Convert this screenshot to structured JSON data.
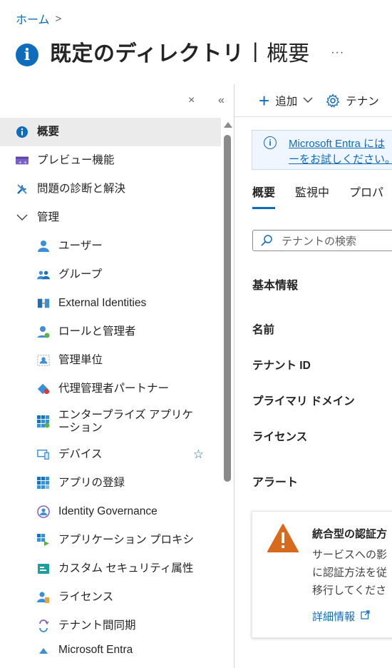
{
  "breadcrumb": {
    "home": "ホーム",
    "sep": ">"
  },
  "header": {
    "title": "既定のディレクトリ",
    "separator": "|",
    "subtitle": "概要",
    "more": "···"
  },
  "sidebar": {
    "collapse_icon": "×",
    "hide_icon": "«",
    "items": [
      {
        "label": "概要",
        "icon": "info-icon",
        "level": 0,
        "active": true
      },
      {
        "label": "プレビュー機能",
        "icon": "preview-features-icon",
        "level": 0
      },
      {
        "label": "問題の診断と解決",
        "icon": "wrench-icon",
        "level": 0
      },
      {
        "label": "管理",
        "icon": "chevron-down-icon",
        "level": 0
      },
      {
        "label": "ユーザー",
        "icon": "user-icon",
        "level": 1
      },
      {
        "label": "グループ",
        "icon": "group-icon",
        "level": 1
      },
      {
        "label": "External Identities",
        "icon": "external-identities-icon",
        "level": 1
      },
      {
        "label": "ロールと管理者",
        "icon": "roles-icon",
        "level": 1
      },
      {
        "label": "管理単位",
        "icon": "admin-units-icon",
        "level": 1
      },
      {
        "label": "代理管理者パートナー",
        "icon": "partner-icon",
        "level": 1
      },
      {
        "label": "エンタープライズ アプリケーション",
        "icon": "enterprise-apps-icon",
        "level": 1
      },
      {
        "label": "デバイス",
        "icon": "devices-icon",
        "level": 1,
        "star": "☆"
      },
      {
        "label": "アプリの登録",
        "icon": "app-registrations-icon",
        "level": 1
      },
      {
        "label": "Identity Governance",
        "icon": "identity-governance-icon",
        "level": 1
      },
      {
        "label": "アプリケーション プロキシ",
        "icon": "app-proxy-icon",
        "level": 1
      },
      {
        "label": "カスタム セキュリティ属性",
        "icon": "security-attributes-icon",
        "level": 1
      },
      {
        "label": "ライセンス",
        "icon": "licenses-icon",
        "level": 1
      },
      {
        "label": "テナント間同期",
        "icon": "sync-icon",
        "level": 1
      },
      {
        "label": "Microsoft Entra",
        "icon": "entra-icon",
        "level": 1
      }
    ]
  },
  "toolbar": {
    "add_label": "追加",
    "tenant_label": "テナン"
  },
  "info_bar": {
    "line1": "Microsoft Entra には",
    "line2": "ーをお試しください。"
  },
  "tabs": [
    "概要",
    "監視中",
    "プロパ"
  ],
  "search": {
    "placeholder": "テナントの検索"
  },
  "basic_info": {
    "heading": "基本情報",
    "name": "名前",
    "tenant_id": "テナント ID",
    "primary_domain": "プライマリ ドメイン",
    "license": "ライセンス"
  },
  "alerts": {
    "heading": "アラート",
    "card": {
      "title": "統合型の認証方",
      "body1": "サービスへの影",
      "body2": "に認証方法を従",
      "body3": "移行してくださ",
      "link": "詳細情報"
    }
  },
  "colors": {
    "accent": "#0f6cbd",
    "warning": "#d86a1e",
    "active_bg": "#ebebeb"
  }
}
